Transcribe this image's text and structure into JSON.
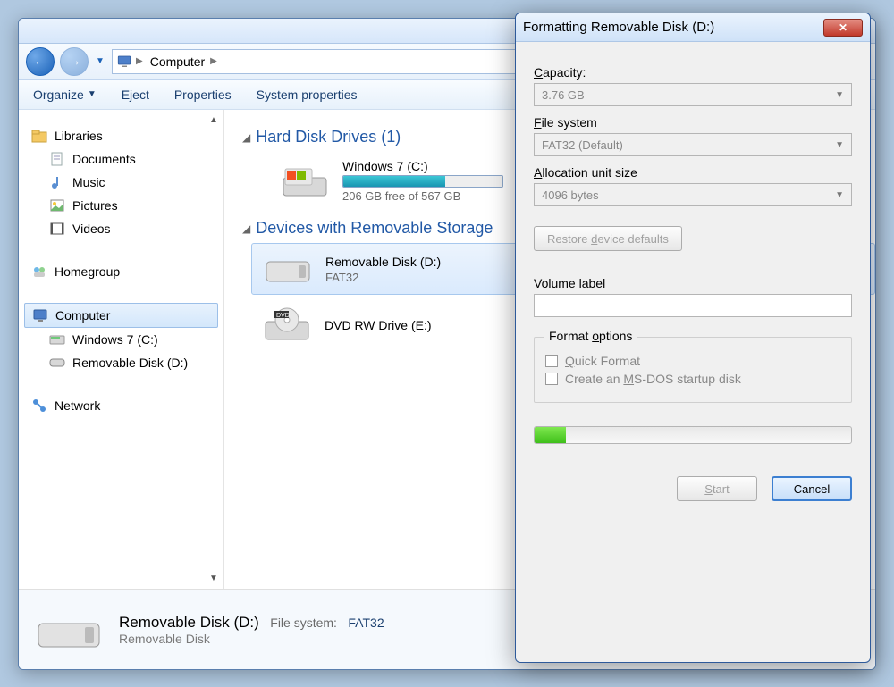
{
  "window_controls": {
    "minimize": "—",
    "maximize": "▢",
    "close": "✕"
  },
  "address": {
    "root": "Computer"
  },
  "toolbar": {
    "organize": "Organize",
    "eject": "Eject",
    "properties": "Properties",
    "system_properties": "System properties"
  },
  "sidebar": {
    "libraries": {
      "label": "Libraries",
      "items": [
        "Documents",
        "Music",
        "Pictures",
        "Videos"
      ]
    },
    "homegroup": "Homegroup",
    "computer": {
      "label": "Computer",
      "items": [
        "Windows 7 (C:)",
        "Removable Disk (D:)"
      ]
    },
    "network": "Network"
  },
  "main": {
    "section_hdd": "Hard Disk Drives (1)",
    "hdd": {
      "title": "Windows 7 (C:)",
      "subtitle": "206 GB free of 567 GB",
      "fill_percent": 64
    },
    "section_removable": "Devices with Removable Storage",
    "removable": {
      "title": "Removable Disk (D:)",
      "subtitle": "FAT32"
    },
    "dvd": {
      "title": "DVD RW Drive (E:)"
    }
  },
  "details": {
    "title": "Removable Disk (D:)",
    "subtitle": "Removable Disk",
    "fs_label": "File system:",
    "fs_value": "FAT32"
  },
  "dialog": {
    "title": "Formatting Removable Disk (D:)",
    "capacity_label": "Capacity:",
    "capacity_value": "3.76 GB",
    "filesystem_label": "File system",
    "filesystem_value": "FAT32 (Default)",
    "allocation_label": "Allocation unit size",
    "allocation_value": "4096 bytes",
    "restore_btn": "Restore device defaults",
    "volume_label": "Volume label",
    "volume_value": "",
    "format_options_label": "Format options",
    "quick_format": "Quick Format",
    "msdos": "Create an MS-DOS startup disk",
    "start_btn": "Start",
    "cancel_btn": "Cancel",
    "progress_percent": 10
  }
}
